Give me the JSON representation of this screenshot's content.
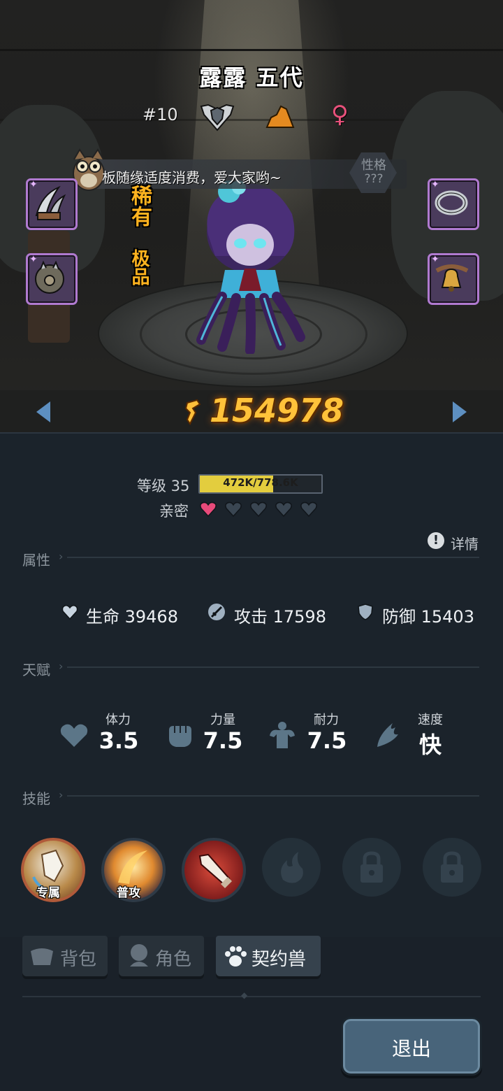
{
  "character": {
    "name": "露露 五代",
    "rank": "#10",
    "chat_message": "板随缘适度消费，爱大家哟~",
    "personality_label": "性格",
    "personality_value": "???",
    "rarity": "稀有",
    "quality": "极品",
    "power": "154978",
    "gender_symbol": "♀"
  },
  "level": {
    "label": "等级 35",
    "xp_text": "472K/778.6K",
    "xp_fraction": 0.606
  },
  "intimacy": {
    "label": "亲密",
    "filled": 1,
    "total": 5
  },
  "detail_label": "详情",
  "attributes": {
    "title": "属性",
    "hp": "生命 39468",
    "atk": "攻击 17598",
    "def": "防御 15403"
  },
  "talents": {
    "title": "天赋",
    "items": [
      {
        "label": "体力",
        "value": "3.5"
      },
      {
        "label": "力量",
        "value": "7.5"
      },
      {
        "label": "耐力",
        "value": "7.5"
      },
      {
        "label": "速度",
        "value": "快"
      }
    ]
  },
  "skills": {
    "title": "技能",
    "exclusive_tag": "专属",
    "normal_tag": "普攻"
  },
  "tabs": {
    "bag": "背包",
    "character": "角色",
    "pet": "契约兽"
  },
  "exit_label": "退出",
  "colors": {
    "accent_gold": "#ffc23a",
    "rarity_orange": "#ffb31f",
    "equip_border": "#b07ad0",
    "heart_active": "#e84a7a",
    "panel_bg": "#1b232b"
  }
}
